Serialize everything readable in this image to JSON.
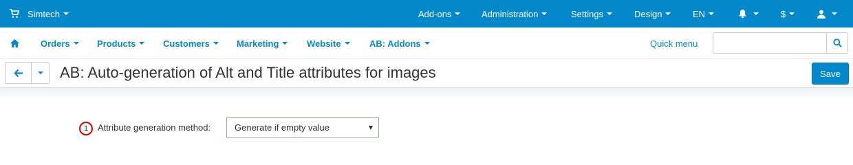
{
  "topbar": {
    "brand": "Simtech",
    "items": [
      {
        "label": "Add-ons"
      },
      {
        "label": "Administration"
      },
      {
        "label": "Settings"
      },
      {
        "label": "Design"
      },
      {
        "label": "EN"
      },
      {
        "label": "$"
      }
    ],
    "bell_icon": "bell-icon",
    "user_icon": "user-icon"
  },
  "menubar": {
    "items": [
      {
        "label": "Orders"
      },
      {
        "label": "Products"
      },
      {
        "label": "Customers"
      },
      {
        "label": "Marketing"
      },
      {
        "label": "Website"
      },
      {
        "label": "AB: Addons"
      }
    ],
    "quick_menu": "Quick menu",
    "search_value": ""
  },
  "titlebar": {
    "title": "AB: Auto-generation of Alt and Title attributes for images",
    "save": "Save"
  },
  "form": {
    "marker": "1",
    "label": "Attribute generation method:",
    "select_value": "Generate if empty value"
  },
  "colors": {
    "accent": "#0388cc",
    "marker": "#e00000"
  }
}
